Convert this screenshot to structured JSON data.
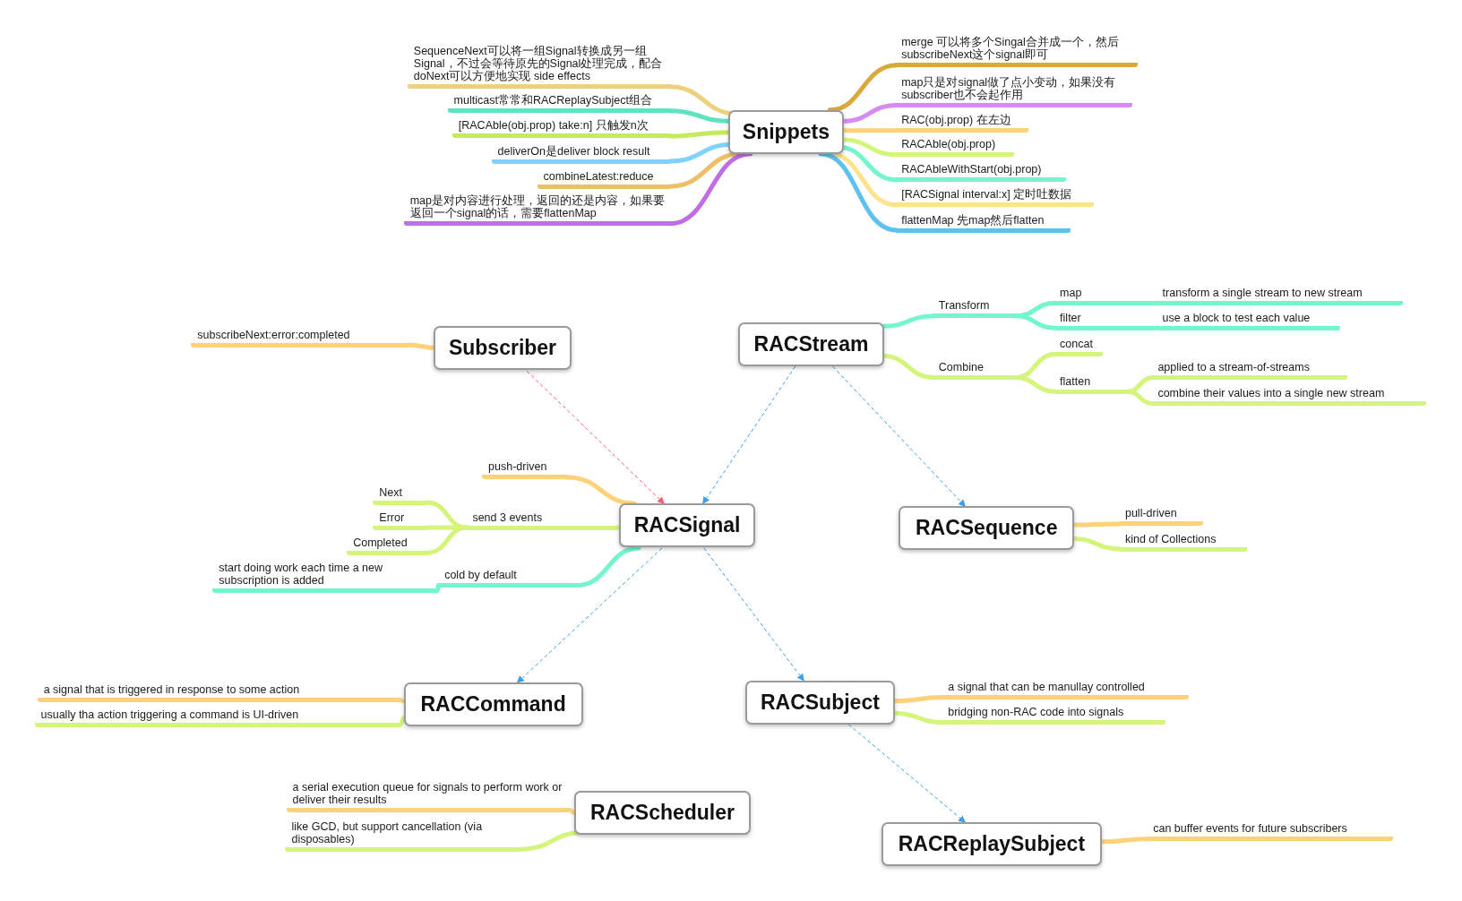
{
  "topics": [
    {
      "title": "Snippets",
      "branches": [
        {
          "text": "SequenceNext可以将一组Signal转换成另一组Signal，不过会等待原先的Signal处理完成，配合doNext可以方便地实现 side effects",
          "color": "#ecd27d"
        },
        {
          "text": "multicast常常和RACReplaySubject组合",
          "color": "#5de3c0"
        },
        {
          "text": "[RACAble(obj.prop) take:n] 只触发n次",
          "color": "#c5ea5a"
        },
        {
          "text": "deliverOn是deliver block result",
          "color": "#7fd3fb"
        },
        {
          "text": "combineLatest:reduce",
          "color": "#eec065"
        },
        {
          "text": "map是对内容进行处理，返回的还是内容，如果要返回一个signal的话，需要flattenMap",
          "color": "#c06ee6"
        },
        {
          "text": "merge 可以将多个Singal合并成一个，然后subscribeNext这个signal即可",
          "color": "#d9a93c"
        },
        {
          "text": "map只是对signal做了点小变动，如果没有subscriber也不会起作用",
          "color": "#d98af0"
        },
        {
          "text": "RAC(obj.prop) 在左边",
          "color": "#ffd27a"
        },
        {
          "text": "RACAble(obj.prop)",
          "color": "#d4f57a"
        },
        {
          "text": "RACAbleWithStart(obj.prop)",
          "color": "#74f5cf"
        },
        {
          "text": "[RACSignal interval:x] 定时吐数据",
          "color": "#ffe38a"
        },
        {
          "text": "flattenMap 先map然后flatten",
          "color": "#5ec1ee"
        }
      ]
    },
    {
      "title": "Subscriber",
      "branches": [
        {
          "text": "subscribeNext:error:completed",
          "color": "#ffd27a"
        }
      ]
    },
    {
      "title": "RACStream",
      "branches": [
        {
          "text": "Transform",
          "color": "#74f5cf",
          "children": [
            {
              "text": "map",
              "color": "#74f5cf",
              "children": [
                {
                  "text": "transform a single stream to new stream",
                  "color": "#74f5cf"
                }
              ]
            },
            {
              "text": "filter",
              "color": "#74f5cf",
              "children": [
                {
                  "text": "use a block to test each value",
                  "color": "#74f5cf"
                }
              ]
            }
          ]
        },
        {
          "text": "Combine",
          "color": "#d4f57a",
          "children": [
            {
              "text": "concat",
              "color": "#d4f57a"
            },
            {
              "text": "flatten",
              "color": "#d4f57a",
              "children": [
                {
                  "text": "applied to a stream-of-streams",
                  "color": "#d4f57a"
                },
                {
                  "text": "combine their values into a single new stream",
                  "color": "#d4f57a"
                }
              ]
            }
          ]
        }
      ]
    },
    {
      "title": "RACSignal",
      "branches": [
        {
          "text": "push-driven",
          "color": "#ffd27a"
        },
        {
          "text": "send 3 events",
          "color": "#d4f57a",
          "children": [
            {
              "text": "Next",
              "color": "#d4f57a"
            },
            {
              "text": "Error",
              "color": "#d4f57a"
            },
            {
              "text": "Completed",
              "color": "#d4f57a"
            }
          ]
        },
        {
          "text": "cold by default",
          "color": "#74f5cf",
          "children": [
            {
              "text": "start doing work each time a new subscription is added",
              "color": "#74f5cf"
            }
          ]
        }
      ]
    },
    {
      "title": "RACSequence",
      "branches": [
        {
          "text": "pull-driven",
          "color": "#ffd27a"
        },
        {
          "text": "kind of Collections",
          "color": "#d4f57a"
        }
      ]
    },
    {
      "title": "RACCommand",
      "branches": [
        {
          "text": "a signal that is triggered in response to some action",
          "color": "#ffd27a"
        },
        {
          "text": "usually tha action triggering a command is UI-driven",
          "color": "#d4f57a"
        }
      ]
    },
    {
      "title": "RACSubject",
      "branches": [
        {
          "text": "a signal that can be manullay controlled",
          "color": "#ffd27a"
        },
        {
          "text": "bridging non-RAC code into signals",
          "color": "#d4f57a"
        }
      ]
    },
    {
      "title": "RACScheduler",
      "branches": [
        {
          "text": "a serial execution queue for signals to perform work or deliver their results",
          "color": "#ffd27a"
        },
        {
          "text": "like GCD, but support cancellation (via disposables)",
          "color": "#d4f57a"
        }
      ]
    },
    {
      "title": "RACReplaySubject",
      "branches": [
        {
          "text": "can buffer events for future subscribers",
          "color": "#ffd27a"
        }
      ]
    }
  ],
  "arrows": [
    {
      "color": "#ff5a6e"
    },
    {
      "color": "#3a9ff0"
    },
    {
      "color": "#3a9ff0"
    },
    {
      "color": "#3a9ff0"
    },
    {
      "color": "#3a9ff0"
    },
    {
      "color": "#3a9ff0"
    }
  ]
}
